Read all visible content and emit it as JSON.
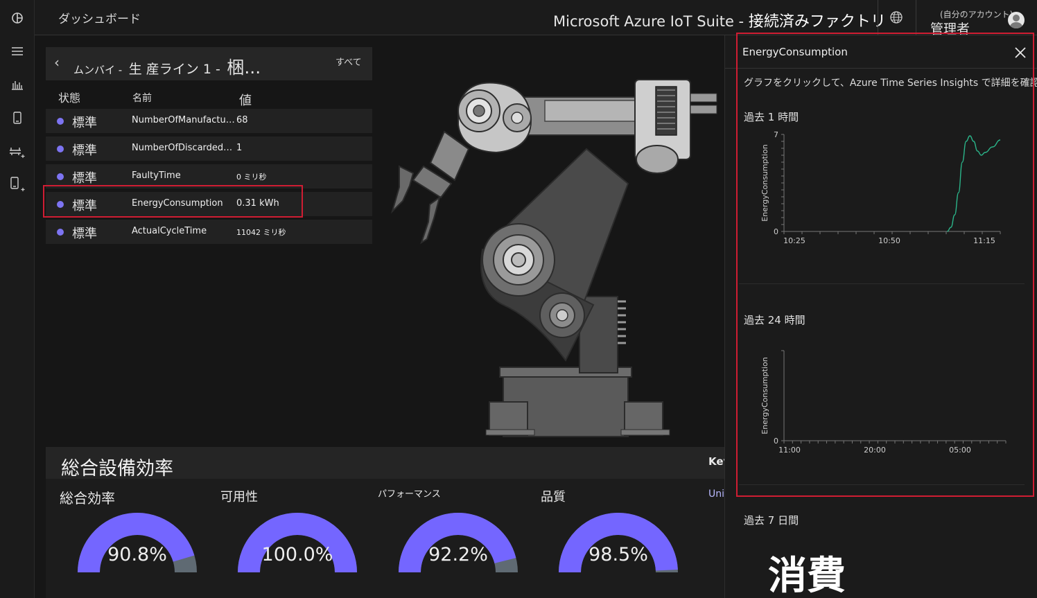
{
  "topbar": {
    "breadcrumb": "ダッシュボード",
    "suite_prefix": "Microsoft Azure IoT Suite - ",
    "suite_name": "接続済みファクトリ",
    "account_sub": "(自分のアカウント)",
    "account_name": "管理者"
  },
  "rail_icons": [
    "logo-icon",
    "menu-icon",
    "analytics-icon",
    "device-icon",
    "add-station-icon",
    "add-device-icon"
  ],
  "device_panel": {
    "path_1": "ムンバイ -",
    "path_2": "生 産ライン 1 -",
    "path_3": "梱...",
    "all_label": "すべて",
    "columns": {
      "status": "状態",
      "name": "名前",
      "value": "値"
    },
    "rows": [
      {
        "status": "標準",
        "name": "NumberOfManufactur...",
        "value": "68"
      },
      {
        "status": "標準",
        "name": "NumberOfDiscardedPr...",
        "value": "1"
      },
      {
        "status": "標準",
        "name": "FaultyTime",
        "value": "0 ミリ秒"
      },
      {
        "status": "標準",
        "name": "EnergyConsumption",
        "value": "0.31 kWh"
      },
      {
        "status": "標準",
        "name": "ActualCycleTime",
        "value": "11042 ミリ秒"
      }
    ],
    "highlighted_row": "EnergyConsumption",
    "status_color": "#7d74f2"
  },
  "oee": {
    "title": "総合設備効率",
    "key_label": "Key",
    "unit_label": "Uni",
    "gauges": [
      {
        "label": "総合効率",
        "value_text": "90.8%",
        "value": 0.908
      },
      {
        "label": "可用性",
        "value_text": "100.0%",
        "value": 1.0
      },
      {
        "label": "パフォーマンス",
        "value_text": "92.2%",
        "value": 0.922
      },
      {
        "label": "品質",
        "value_text": "98.5%",
        "value": 0.985
      }
    ],
    "gauge_color": "#7466ff",
    "gauge_track": "#5f6a73"
  },
  "flyout": {
    "title": "EnergyConsumption",
    "hint": "グラフをクリックして、Azure Time Series Insights で詳細を確認する",
    "sections": [
      {
        "label": "過去 1 時間"
      },
      {
        "label": "過去 24 時間"
      },
      {
        "label": "過去 7 日間"
      }
    ],
    "big_word": "消費",
    "highlight_color": "#d01d33"
  },
  "chart_data": [
    {
      "type": "line",
      "title": "過去 1 時間",
      "ylabel": "EnergyConsumption",
      "ylim": [
        0,
        7
      ],
      "y_ticks": [
        "0",
        "7"
      ],
      "x_ticks": [
        "10:25",
        "10:50",
        "11:15"
      ],
      "series": [
        {
          "color": "#2bb58a",
          "points": [
            [
              "11:03",
              0
            ],
            [
              "11:04",
              0.3
            ],
            [
              "11:05",
              1.2
            ],
            [
              "11:06",
              2.8
            ],
            [
              "11:07",
              5.0
            ],
            [
              "11:08",
              6.5
            ],
            [
              "11:09",
              6.9
            ],
            [
              "11:10",
              6.5
            ],
            [
              "11:11",
              5.8
            ],
            [
              "11:12",
              5.5
            ],
            [
              "11:13",
              5.7
            ],
            [
              "11:15",
              6.1
            ],
            [
              "11:17",
              6.6
            ]
          ]
        }
      ]
    },
    {
      "type": "line",
      "title": "過去 24 時間",
      "ylabel": "EnergyConsumption",
      "y_ticks": [
        "0"
      ],
      "x_ticks": [
        "11:00",
        "20:00",
        "05:00"
      ],
      "series": []
    }
  ]
}
